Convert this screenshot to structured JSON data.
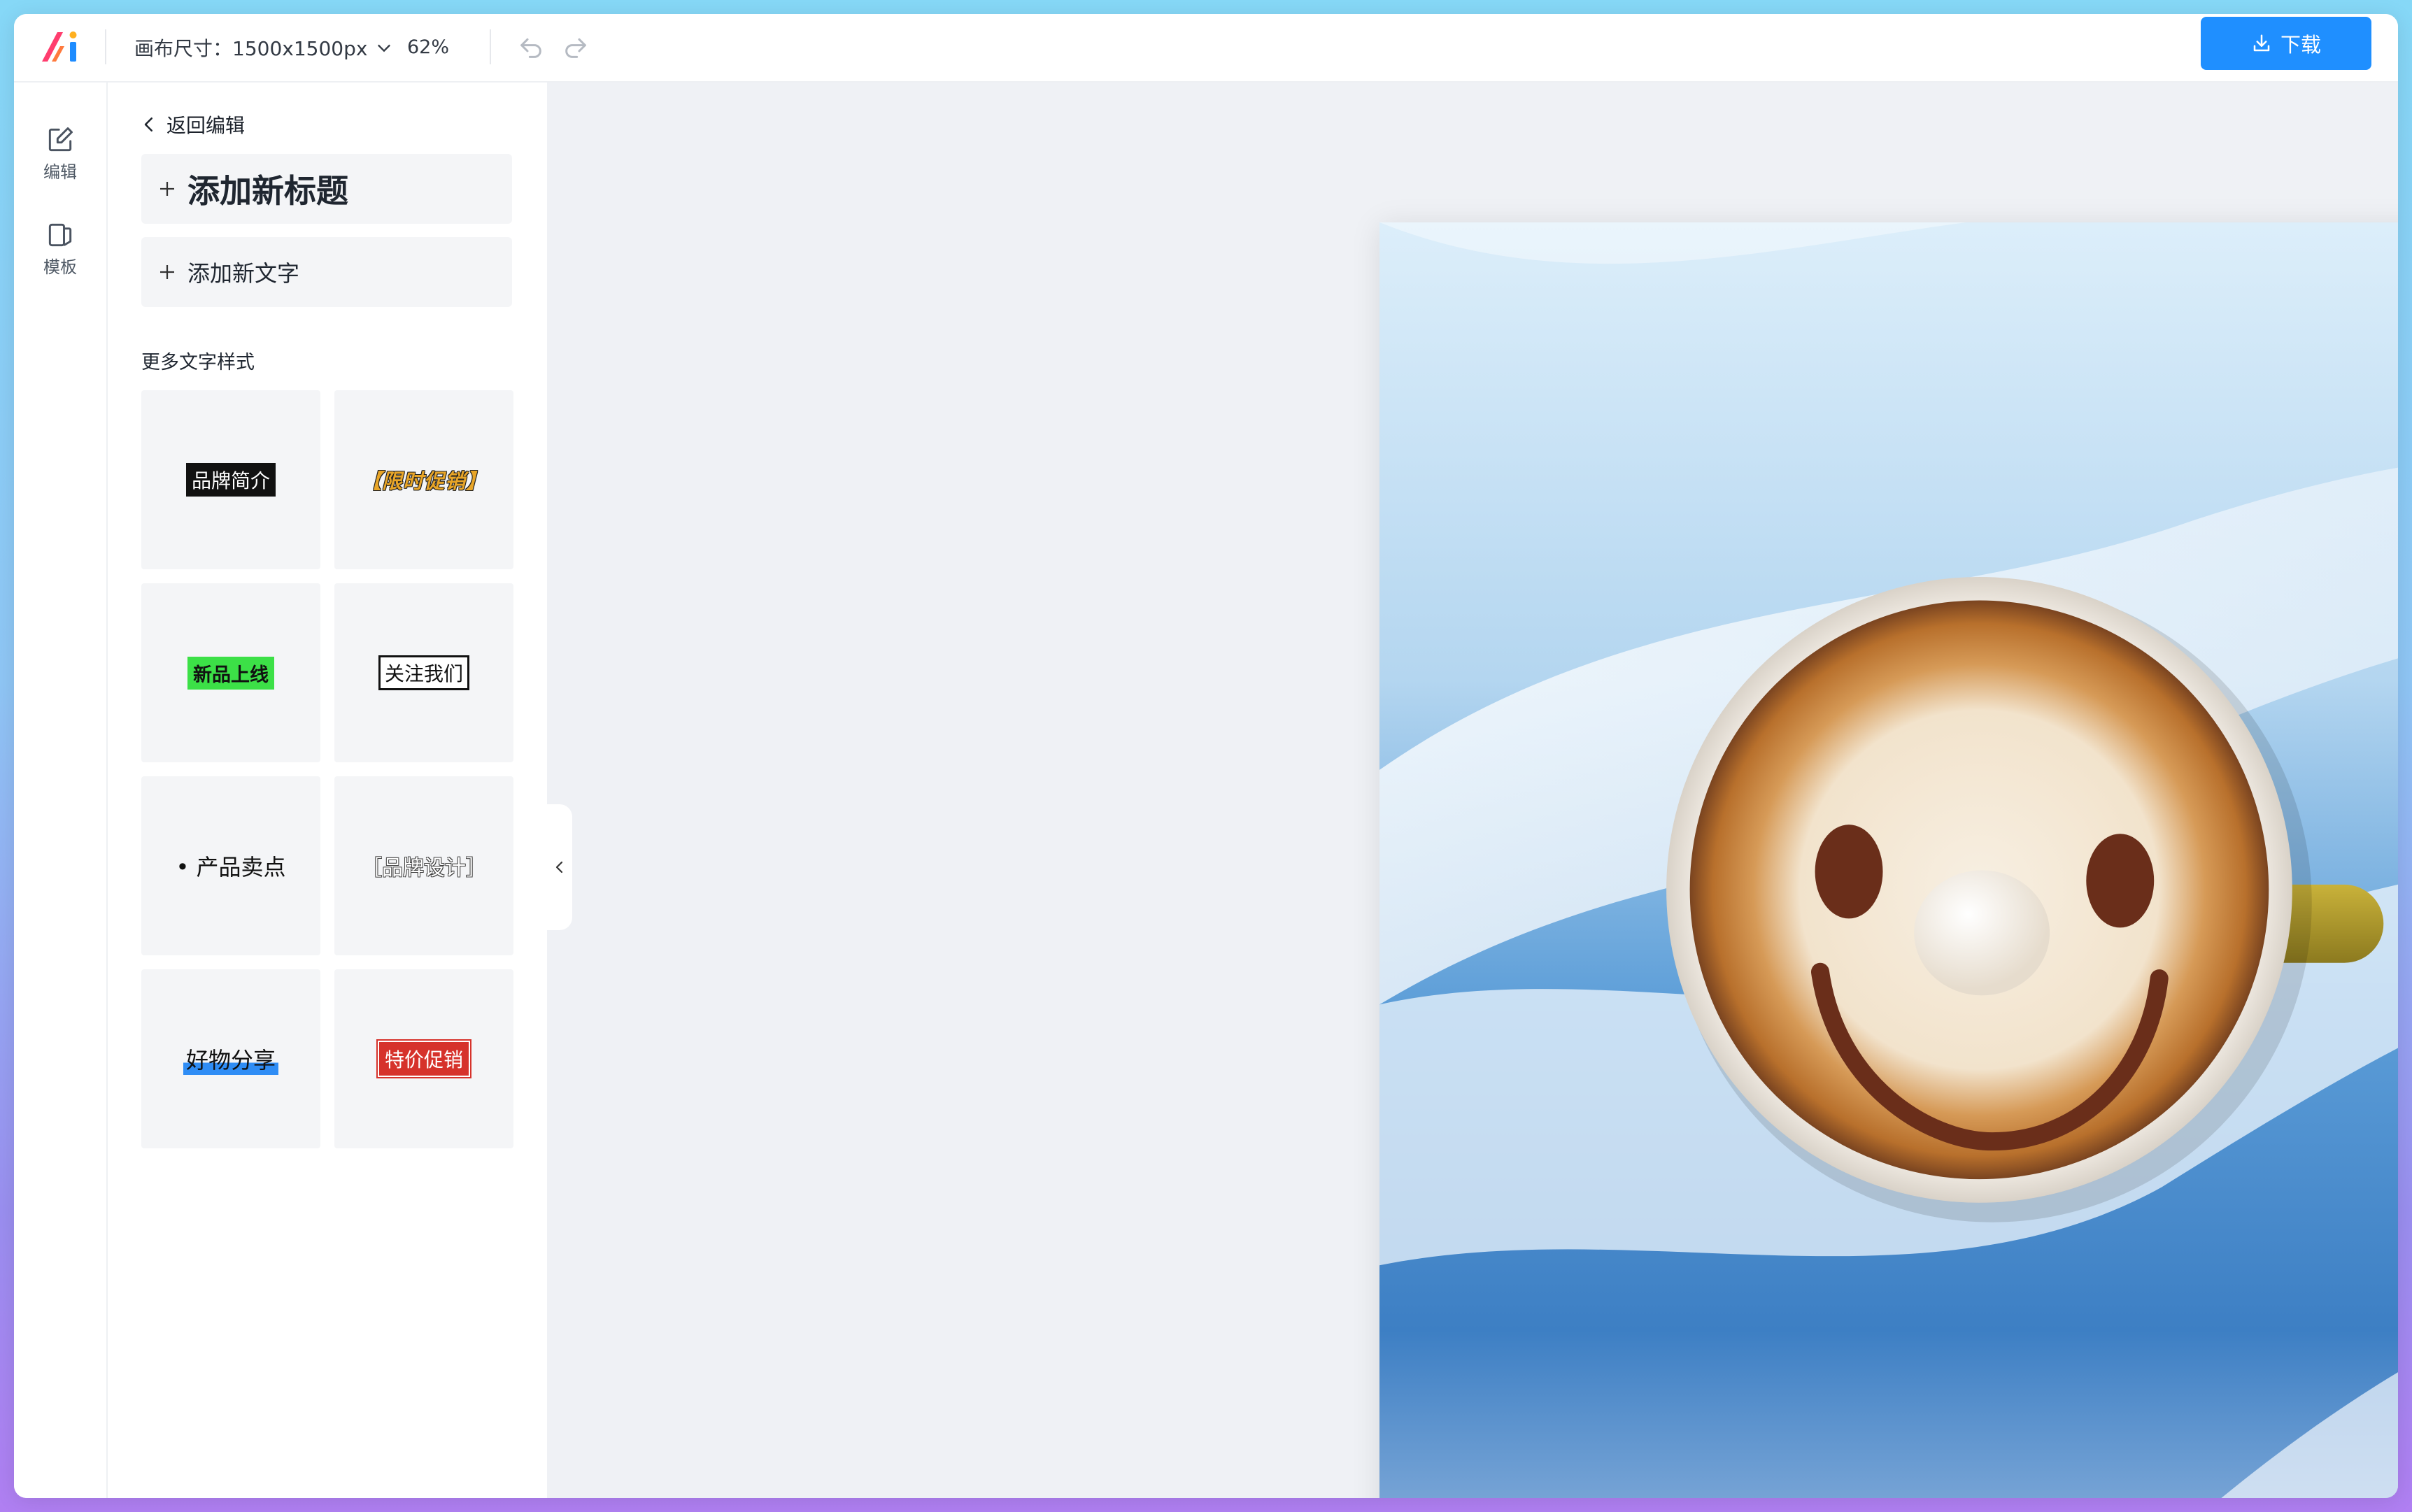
{
  "app": {
    "canvas_size_label": "画布尺寸：1500x1500px",
    "zoom_label": "62%",
    "download_label": "下载"
  },
  "rail": {
    "edit_label": "编辑",
    "templates_label": "模板"
  },
  "panel": {
    "back_label": "返回编辑",
    "add_title_label": "添加新标题",
    "add_text_label": "添加新文字",
    "more_styles_label": "更多文字样式",
    "styles": [
      {
        "text": "品牌简介"
      },
      {
        "text": "【限时促销】"
      },
      {
        "text": "新品上线"
      },
      {
        "text": "关注我们"
      },
      {
        "text": "• 产品卖点"
      },
      {
        "text": "［品牌设计］"
      },
      {
        "text": "好物分享"
      },
      {
        "text": "特价促销"
      }
    ]
  },
  "colors": {
    "accent": "#1f8fff",
    "panel_bg": "#f4f5f7",
    "stage_bg": "#eff1f5"
  },
  "icons": {
    "logo": "app-logo",
    "edit": "edit-icon",
    "templates": "template-icon",
    "download": "download-icon",
    "undo": "undo-icon",
    "redo": "redo-icon"
  }
}
